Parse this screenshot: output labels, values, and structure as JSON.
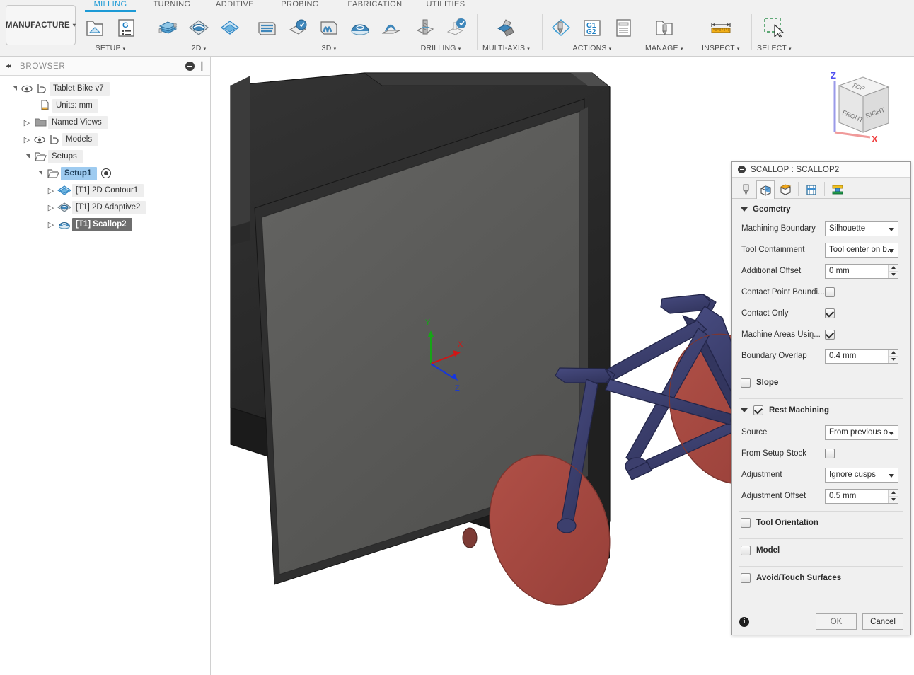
{
  "toolbar": {
    "workspace_button": {
      "label": "MANUFACTURE",
      "caret": "▾"
    },
    "tabs": [
      {
        "name": "milling",
        "label": "MILLING",
        "active": true
      },
      {
        "name": "turning",
        "label": "TURNING",
        "active": false
      },
      {
        "name": "additive",
        "label": "ADDITIVE",
        "active": false
      },
      {
        "name": "probing",
        "label": "PROBING",
        "active": false
      },
      {
        "name": "fabrication",
        "label": "FABRICATION",
        "active": false
      },
      {
        "name": "utilities",
        "label": "UTILITIES",
        "active": false
      }
    ],
    "groups": [
      {
        "name": "setup",
        "label": "SETUP",
        "caret": "▾",
        "icons": [
          "setup-folder-icon",
          "g-code-list-icon"
        ]
      },
      {
        "name": "2d",
        "label": "2D",
        "caret": "▾",
        "icons": [
          "face-icon",
          "2d-adaptive-icon",
          "2d-contour-icon"
        ]
      },
      {
        "name": "3d",
        "label": "3D",
        "caret": "▾",
        "icons": [
          "adaptive-clearing-icon",
          "pocket-clearing-icon",
          "parallel-icon",
          "scallop-icon",
          "spiral-icon"
        ]
      },
      {
        "name": "drilling",
        "label": "DRILLING",
        "caret": "▾",
        "icons": [
          "drill-icon",
          "thread-icon"
        ]
      },
      {
        "name": "multi-axis",
        "label": "MULTI-AXIS",
        "caret": "▾",
        "icons": [
          "swarf-icon"
        ]
      },
      {
        "name": "actions",
        "label": "ACTIONS",
        "caret": "▾",
        "icons": [
          "simulate-icon",
          "g1g2-post-process-icon",
          "setup-sheet-icon"
        ]
      },
      {
        "name": "manage",
        "label": "MANAGE",
        "caret": "▾",
        "icons": [
          "tool-library-icon"
        ]
      },
      {
        "name": "inspect",
        "label": "INSPECT",
        "caret": "▾",
        "icons": [
          "measure-ruler-icon"
        ]
      },
      {
        "name": "select",
        "label": "SELECT",
        "caret": "▾",
        "icons": [
          "selection-filter-icon"
        ]
      }
    ]
  },
  "browser": {
    "title": "BROWSER",
    "collapse_glyph": "◂◂",
    "tree": [
      {
        "name": "tablet-bike-v7",
        "label": "Tablet Bike v7",
        "indent": 0,
        "expander": "open",
        "eye": true,
        "icon": "component-icon",
        "state": "normal"
      },
      {
        "name": "units",
        "label": "Units: mm",
        "indent": 1,
        "expander": "none",
        "eye": false,
        "icon": "document-units-icon",
        "state": "normal"
      },
      {
        "name": "named-views",
        "label": "Named Views",
        "indent": 1,
        "expander": "closed",
        "eye": false,
        "icon": "folder-icon",
        "state": "normal"
      },
      {
        "name": "models",
        "label": "Models",
        "indent": 1,
        "expander": "closed",
        "eye": true,
        "icon": "component-icon",
        "state": "normal"
      },
      {
        "name": "setups",
        "label": "Setups",
        "indent": 1,
        "expander": "open",
        "eye": false,
        "icon": "setup-folder-icon",
        "state": "normal"
      },
      {
        "name": "setup1",
        "label": "Setup1",
        "indent": 2,
        "expander": "open",
        "eye": false,
        "icon": "setup-folder-icon",
        "state": "selected-blue",
        "trailing_icon": "active-setup-target-icon"
      },
      {
        "name": "op-2d-contour1",
        "label": "[T1] 2D Contour1",
        "indent": 3,
        "expander": "closed",
        "eye": false,
        "icon": "2d-contour-icon",
        "state": "normal"
      },
      {
        "name": "op-2d-adaptive2",
        "label": "[T1] 2D Adaptive2",
        "indent": 3,
        "expander": "closed",
        "eye": false,
        "icon": "2d-adaptive-icon",
        "state": "normal"
      },
      {
        "name": "op-scallop2",
        "label": "[T1] Scallop2",
        "indent": 3,
        "expander": "closed",
        "eye": false,
        "icon": "scallop-icon",
        "state": "selected-gray"
      }
    ]
  },
  "viewcube": {
    "top_face": "TOP",
    "front_face": "FRONT",
    "right_face": "RIGHT",
    "axis_z": "Z",
    "axis_x": "X"
  },
  "canvas": {
    "origin_triad": {
      "x_label": "X",
      "y_label": "Y",
      "z_label": "Z"
    },
    "colors": {
      "tablet_body": "#2b2b2b",
      "tablet_screen": "#5e5e5c",
      "bike_frame": "#3f4272",
      "wheel_pocket": "#a94a42",
      "background": "#ffffff"
    }
  },
  "dialog": {
    "title": "SCALLOP : SCALLOP2",
    "tabs": [
      {
        "name": "tool-tab",
        "icon": "tool-icon",
        "active": false
      },
      {
        "name": "geometry-tab",
        "icon": "geometry-cube-icon",
        "active": true
      },
      {
        "name": "heights-tab",
        "icon": "heights-cube-icon",
        "active": false
      },
      {
        "name": "passes-tab",
        "icon": "passes-icon",
        "active": false
      },
      {
        "name": "linking-tab",
        "icon": "linking-icon",
        "active": false
      }
    ],
    "geometry": {
      "header": "Geometry",
      "expanded": true,
      "fields": [
        {
          "name": "machining-boundary",
          "label": "Machining Boundary",
          "type": "select",
          "value": "Silhouette"
        },
        {
          "name": "tool-containment",
          "label": "Tool Containment",
          "type": "select",
          "value": "Tool center on b..."
        },
        {
          "name": "additional-offset",
          "label": "Additional Offset",
          "type": "spinner",
          "value": "0 mm"
        },
        {
          "name": "contact-point-boundary",
          "label": "Contact Point Boundi...",
          "type": "checkbox",
          "checked": false
        },
        {
          "name": "contact-only",
          "label": "Contact Only",
          "type": "checkbox",
          "checked": true
        },
        {
          "name": "machine-areas-using",
          "label": "Machine Areas Usin̨...",
          "type": "checkbox",
          "checked": true
        },
        {
          "name": "boundary-overlap",
          "label": "Boundary Overlap",
          "type": "spinner",
          "value": "0.4 mm"
        }
      ]
    },
    "slope": {
      "name": "slope",
      "label": "Slope",
      "checked": false
    },
    "rest_machining": {
      "header": "Rest Machining",
      "checked": true,
      "expanded": true,
      "fields": [
        {
          "name": "source",
          "label": "Source",
          "type": "select",
          "value": "From previous o..."
        },
        {
          "name": "from-setup-stock",
          "label": "From Setup Stock",
          "type": "checkbox",
          "checked": false
        },
        {
          "name": "adjustment",
          "label": "Adjustment",
          "type": "select",
          "value": "Ignore cusps"
        },
        {
          "name": "adjustment-offset",
          "label": "Adjustment Offset",
          "type": "spinner",
          "value": "0.5 mm"
        }
      ]
    },
    "collapsed_sections": [
      {
        "name": "tool-orientation",
        "label": "Tool Orientation",
        "checked": false
      },
      {
        "name": "model",
        "label": "Model",
        "checked": false
      },
      {
        "name": "avoid-touch-surfaces",
        "label": "Avoid/Touch Surfaces",
        "checked": false
      }
    ],
    "footer": {
      "info_glyph": "i",
      "ok_label": "OK",
      "cancel_label": "Cancel"
    }
  },
  "colors": {
    "accent_blue": "#1c9ad6",
    "selection_blue": "#9ecbf0",
    "selection_gray": "#6e6e6e",
    "toolbar_bg": "#f1f1f1",
    "panel_bg": "#f0f0f0"
  }
}
